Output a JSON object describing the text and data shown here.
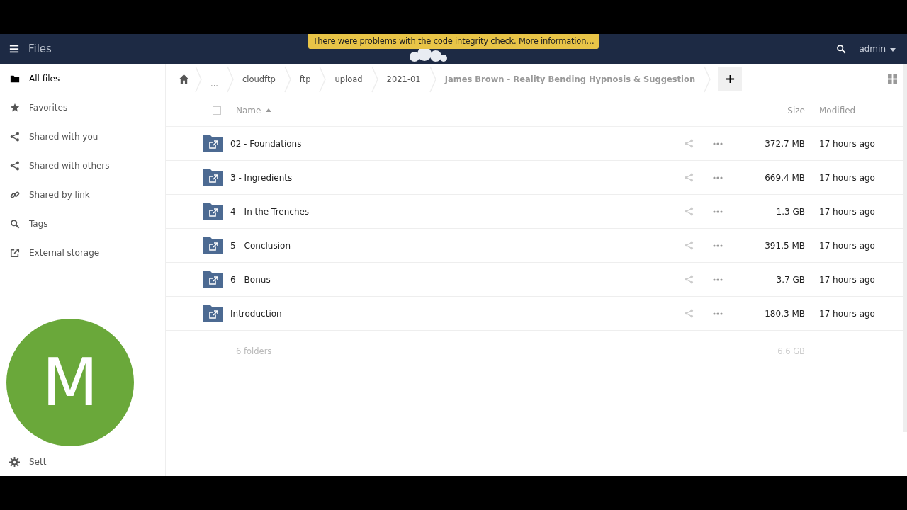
{
  "header": {
    "app_title": "Files",
    "notification": "There were problems with the code integrity check. More information…",
    "user": "admin"
  },
  "sidebar": {
    "items": [
      {
        "label": "All files",
        "selected": true
      },
      {
        "label": "Favorites",
        "selected": false
      },
      {
        "label": "Shared with you",
        "selected": false
      },
      {
        "label": "Shared with others",
        "selected": false
      },
      {
        "label": "Shared by link",
        "selected": false
      },
      {
        "label": "Tags",
        "selected": false
      },
      {
        "label": "External storage",
        "selected": false
      }
    ],
    "settings": "Sett"
  },
  "breadcrumbs": [
    "...",
    "cloudftp",
    "ftp",
    "upload",
    "2021-01",
    "James Brown - Reality Bending Hypnosis & Suggestion"
  ],
  "table": {
    "select_all": {
      "checked": false
    },
    "columns": [
      "Name",
      "Size",
      "Modified"
    ],
    "rows": [
      {
        "name": "02 - Foundations",
        "size": "372.7 MB",
        "modified": "17 hours ago"
      },
      {
        "name": "3 - Ingredients",
        "size": "669.4 MB",
        "modified": "17 hours ago"
      },
      {
        "name": "4 - In the Trenches",
        "size": "1.3 GB",
        "modified": "17 hours ago"
      },
      {
        "name": "5 - Conclusion",
        "size": "391.5 MB",
        "modified": "17 hours ago"
      },
      {
        "name": "6 - Bonus",
        "size": "3.7 GB",
        "modified": "17 hours ago"
      },
      {
        "name": "Introduction",
        "size": "180.3 MB",
        "modified": "17 hours ago"
      }
    ],
    "summary": {
      "count": "6 folders",
      "size": "6.6 GB"
    }
  },
  "avatar": {
    "letter": "M"
  }
}
